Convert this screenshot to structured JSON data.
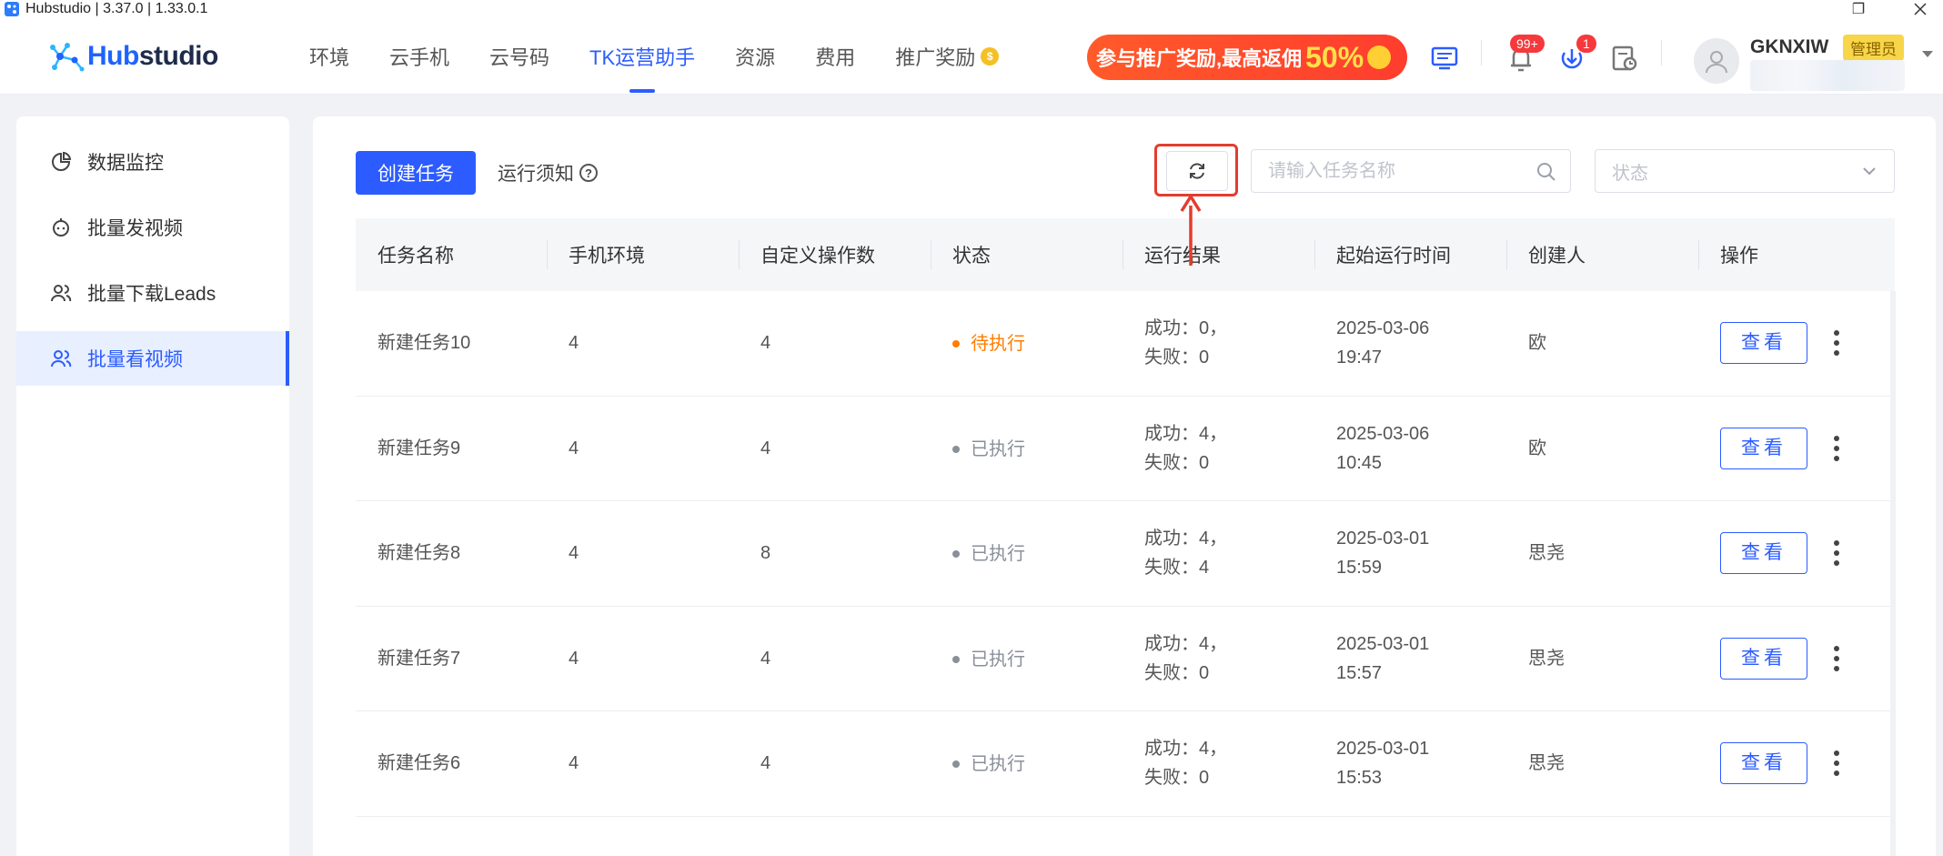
{
  "window": {
    "title": "Hubstudio | 3.37.0 | 1.33.0.1",
    "restore_glyph": "❐"
  },
  "header": {
    "logo_part1": "Hub",
    "logo_part2": "studio",
    "nav": [
      {
        "label": "环境"
      },
      {
        "label": "云手机"
      },
      {
        "label": "云号码"
      },
      {
        "label": "TK运营助手",
        "active": true
      },
      {
        "label": "资源"
      },
      {
        "label": "费用"
      },
      {
        "label": "推广奖励"
      }
    ],
    "promo": {
      "text": "参与推广奖励,最高返佣",
      "percent": "50%"
    },
    "notifications_badge": "99+",
    "downloads_badge": "1",
    "user": {
      "name": "GKNXIW",
      "role": "管理员"
    }
  },
  "sidebar": {
    "items": [
      {
        "label": "数据监控",
        "icon": "pie-chart-icon"
      },
      {
        "label": "批量发视频",
        "icon": "robot-icon"
      },
      {
        "label": "批量下载Leads",
        "icon": "users-icon"
      },
      {
        "label": "批量看视频",
        "icon": "users-icon",
        "active": true
      }
    ]
  },
  "toolbar": {
    "create_label": "创建任务",
    "notice_label": "运行须知",
    "notice_icon_text": "?",
    "search_placeholder": "请输入任务名称",
    "status_placeholder": "状态"
  },
  "table": {
    "headers": [
      "任务名称",
      "手机环境",
      "自定义操作数",
      "状态",
      "运行结果",
      "起始运行时间",
      "创建人",
      "操作"
    ],
    "view_label": "查看",
    "rows": [
      {
        "name": "新建任务10",
        "env": "4",
        "ops": "4",
        "status": "待执行",
        "status_type": "pending",
        "success": "成功：0，",
        "fail": "失败：0",
        "date": "2025-03-06",
        "time": "19:47",
        "creator": "欧"
      },
      {
        "name": "新建任务9",
        "env": "4",
        "ops": "4",
        "status": "已执行",
        "status_type": "done",
        "success": "成功：4，",
        "fail": "失败：0",
        "date": "2025-03-06",
        "time": "10:45",
        "creator": "欧"
      },
      {
        "name": "新建任务8",
        "env": "4",
        "ops": "8",
        "status": "已执行",
        "status_type": "done",
        "success": "成功：4，",
        "fail": "失败：4",
        "date": "2025-03-01",
        "time": "15:59",
        "creator": "思尧"
      },
      {
        "name": "新建任务7",
        "env": "4",
        "ops": "4",
        "status": "已执行",
        "status_type": "done",
        "success": "成功：4，",
        "fail": "失败：0",
        "date": "2025-03-01",
        "time": "15:57",
        "creator": "思尧"
      },
      {
        "name": "新建任务6",
        "env": "4",
        "ops": "4",
        "status": "已执行",
        "status_type": "done",
        "success": "成功：4，",
        "fail": "失败：0",
        "date": "2025-03-01",
        "time": "15:53",
        "creator": "思尧"
      }
    ]
  },
  "colors": {
    "primary": "#2c5cff",
    "pending": "#ff7d00",
    "done": "#8a8f99",
    "highlight": "#e23d2e"
  }
}
